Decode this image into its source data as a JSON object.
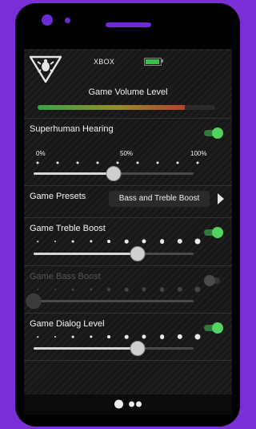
{
  "status": {
    "device_label": "XBOX",
    "battery_level": 0.85,
    "battery_color": "#39c24a",
    "logo_icon": "turtle-beach-logo-icon"
  },
  "game_volume": {
    "label": "Game Volume Level",
    "level": 0.83
  },
  "superhuman_hearing": {
    "label": "Superhuman Hearing",
    "enabled": true,
    "tick_labels": [
      "0%",
      "50%",
      "100%"
    ],
    "tick_count": 9,
    "value": 0.5
  },
  "game_presets": {
    "label": "Game Presets",
    "selected": "Bass and Treble Boost",
    "next_icon": "chevron-right-icon"
  },
  "game_treble_boost": {
    "label": "Game Treble Boost",
    "enabled": true,
    "tick_count": 10,
    "value": 0.65
  },
  "game_bass_boost": {
    "label": "Game Bass Boost",
    "enabled": false,
    "tick_count": 10,
    "value": 0.0
  },
  "game_dialog_level": {
    "label": "Game Dialog Level",
    "enabled": true,
    "tick_count": 10,
    "value": 0.65
  },
  "pager": {
    "total": 3,
    "current": 1
  },
  "colors": {
    "frame": "#7a2fd6",
    "toggle_on": "#54d25e",
    "volume_gradient": [
      "#35a642",
      "#9a8a2c",
      "#b2432a"
    ]
  }
}
